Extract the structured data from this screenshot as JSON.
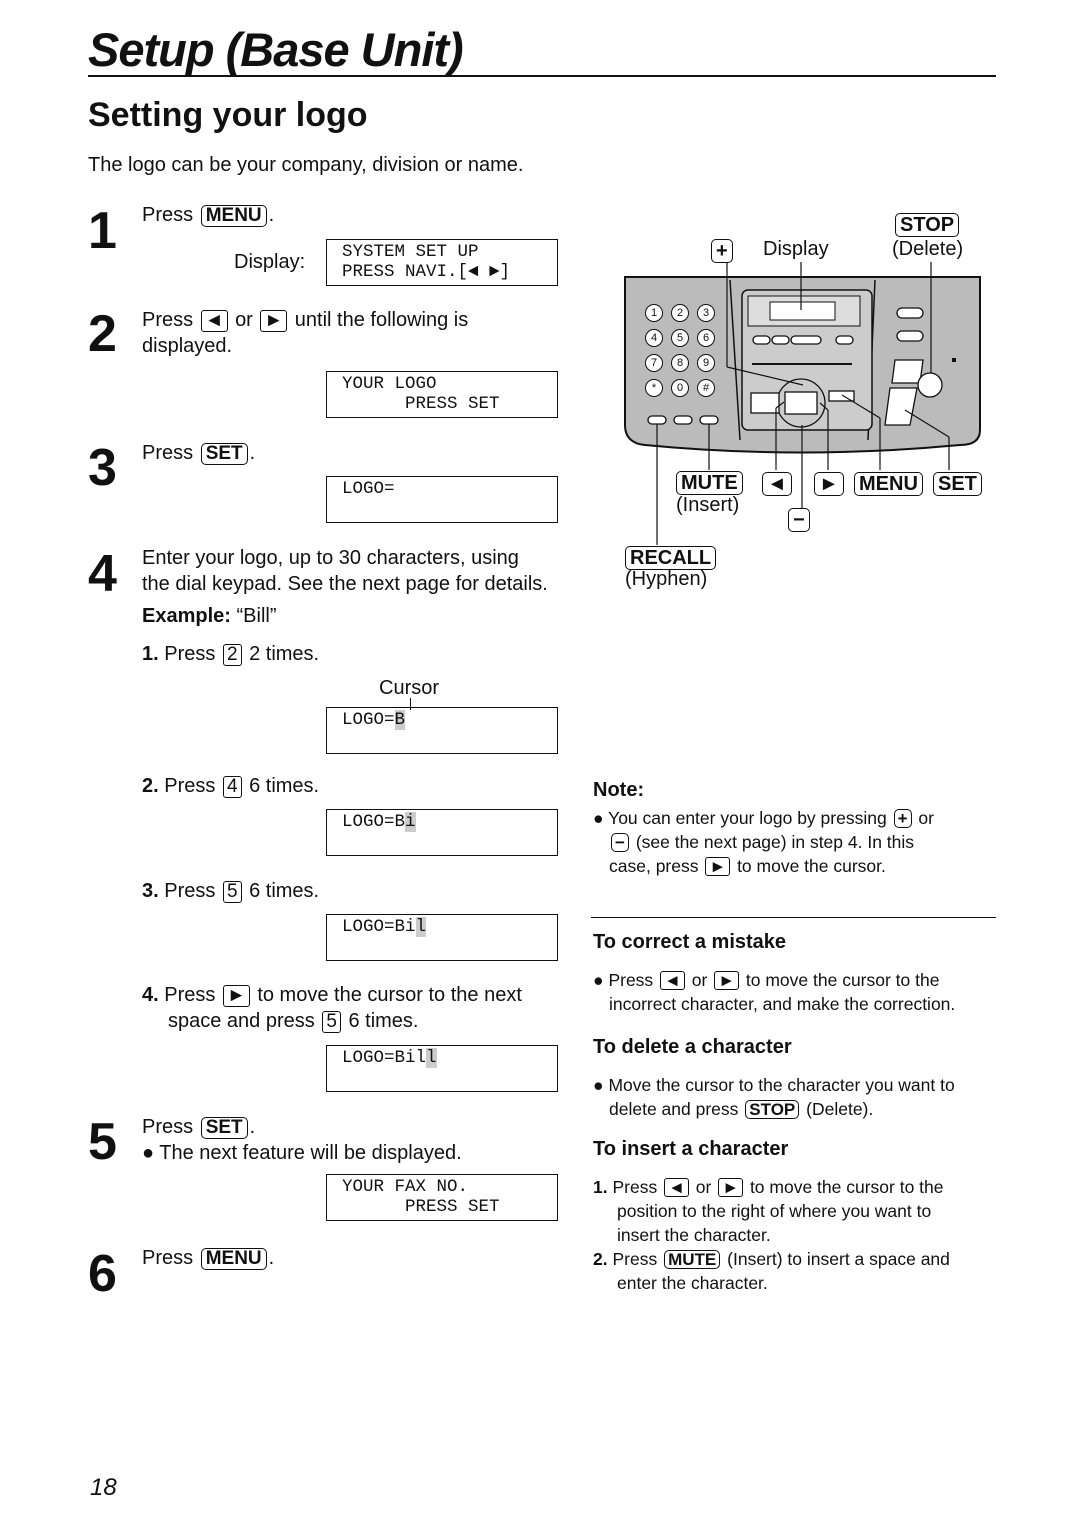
{
  "header": {
    "title": "Setup (Base Unit)",
    "section_title": "Setting your logo",
    "intro": "The logo can be your company, division or name."
  },
  "steps": {
    "s1": {
      "num": "1",
      "press": "Press",
      "key": "MENU",
      "period": ".",
      "display_label": "Display:",
      "display": [
        "SYSTEM SET UP",
        "PRESS NAVI.[◄ ►]"
      ]
    },
    "s2": {
      "num": "2",
      "press": "Press",
      "or": "or",
      "rest": "until the following is",
      "line2": "displayed.",
      "display": [
        "YOUR LOGO",
        "      PRESS SET"
      ]
    },
    "s3": {
      "num": "3",
      "press": "Press",
      "key": "SET",
      "period": ".",
      "display": [
        "LOGO="
      ]
    },
    "s4": {
      "num": "4",
      "line1": "Enter your logo, up to 30 characters, using",
      "line2": "the dial keypad. See the next page for details.",
      "example_label": "Example:",
      "example_value": "“Bill”",
      "sub": [
        {
          "n": "1.",
          "press": "Press",
          "key": "2",
          "times": "2 times.",
          "cursor_label": "Cursor",
          "display": "LOGO=",
          "cursor": "B"
        },
        {
          "n": "2.",
          "press": "Press",
          "key": "4",
          "times": "6 times.",
          "display": "LOGO=B",
          "cursor": "i"
        },
        {
          "n": "3.",
          "press": "Press",
          "key": "5",
          "times": "6 times.",
          "display": "LOGO=Bi",
          "cursor": "l"
        },
        {
          "n": "4.",
          "press": "Press",
          "rest": "to move the cursor to the next",
          "line2": "space and press",
          "key": "5",
          "times": "6 times.",
          "display": "LOGO=Bil",
          "cursor": "l"
        }
      ]
    },
    "s5": {
      "num": "5",
      "press": "Press",
      "key": "SET",
      "period": ".",
      "bullet": "The next feature will be displayed.",
      "display": [
        "YOUR FAX NO.",
        "      PRESS SET"
      ]
    },
    "s6": {
      "num": "6",
      "press": "Press",
      "key": "MENU",
      "period": "."
    }
  },
  "diagram": {
    "plus": "+",
    "display": "Display",
    "stop": "STOP",
    "delete": "(Delete)",
    "mute": "MUTE",
    "insert": "(Insert)",
    "left": "◄",
    "right": "►",
    "menu": "MENU",
    "set": "SET",
    "minus": "−",
    "recall": "RECALL",
    "hyphen": "(Hyphen)",
    "keypad": [
      "1",
      "2",
      "3",
      "4",
      "5",
      "6",
      "7",
      "8",
      "9",
      "*",
      "0",
      "#"
    ]
  },
  "note": {
    "title": "Note:",
    "l1": "You can enter your logo by pressing",
    "or": "or",
    "l2": "(see the next page) in step 4. In this",
    "l3a": "case, press",
    "l3b": "to move the cursor."
  },
  "correct": {
    "title": "To correct a mistake",
    "press": "Press",
    "or": "or",
    "l1": "to move the cursor to the",
    "l2": "incorrect character, and make the correction."
  },
  "delete": {
    "title": "To delete a character",
    "l1": "Move the cursor to the character you want to",
    "l2a": "delete and press",
    "key": "STOP",
    "l2b": "(Delete)."
  },
  "insert": {
    "title": "To insert a character",
    "i1n": "1.",
    "press": "Press",
    "or": "or",
    "l1": "to move the cursor to the",
    "l2": "position to the right of where you want to",
    "l3": "insert the character.",
    "i2n": "2.",
    "key": "MUTE",
    "l4": "(Insert) to insert a space and",
    "l5": "enter the character."
  },
  "page_number": "18"
}
